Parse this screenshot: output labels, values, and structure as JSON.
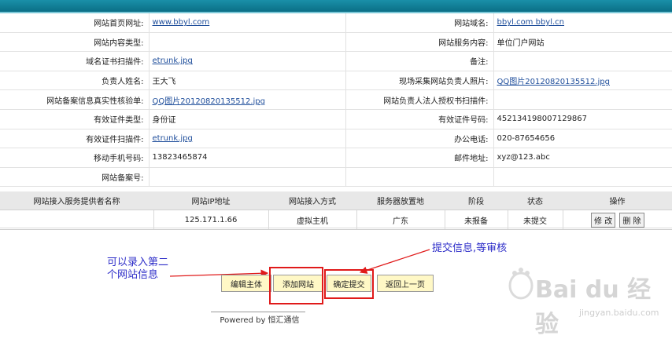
{
  "info_rows": [
    {
      "l1": "网站首页网址:",
      "v1": "www.bbyl.com",
      "l2": "网站域名:",
      "v2": "bbyl.com  bbyl.cn"
    },
    {
      "l1": "网站内容类型:",
      "v1": "",
      "l2": "网站服务内容:",
      "v2": "单位门户网站"
    },
    {
      "l1": "域名证书扫描件:",
      "v1": "etrunk.jpg",
      "l2": "备注:",
      "v2": ""
    },
    {
      "l1": "负责人姓名:",
      "v1": "王大飞",
      "l2": "现场采集网站负责人照片:",
      "v2": "QQ图片20120820135512.jpg"
    },
    {
      "l1": "网站备案信息真实性核验单:",
      "v1": "QQ图片20120820135512.jpg",
      "l2": "网站负责人法人授权书扫描件:",
      "v2": ""
    },
    {
      "l1": "有效证件类型:",
      "v1": "身份证",
      "l2": "有效证件号码:",
      "v2": "452134198007129867"
    },
    {
      "l1": "有效证件扫描件:",
      "v1": "etrunk.jpg",
      "l2": "办公电话:",
      "v2": "020-87654656"
    },
    {
      "l1": "移动手机号码:",
      "v1": "13823465874",
      "l2": "邮件地址:",
      "v2": "xyz@123.abc"
    },
    {
      "l1": "网站备案号:",
      "v1": "",
      "l2": "",
      "v2": ""
    }
  ],
  "service_table": {
    "headers": [
      "网站接入服务提供者名称",
      "网站IP地址",
      "网站接入方式",
      "服务器放置地",
      "阶段",
      "状态",
      "操作"
    ],
    "row": {
      "provider": "",
      "ip": "125.171.1.66",
      "method": "虚拟主机",
      "location": "广东",
      "stage": "未报备",
      "status": "未提交",
      "edit": "修 改",
      "delete": "删 除"
    }
  },
  "buttons": {
    "edit_entity": "编辑主体",
    "add_site": "添加网站",
    "confirm_submit": "确定提交",
    "back": "返回上一页"
  },
  "annotations": {
    "left_line1": "可以录入第二",
    "left_line2": "个网站信息",
    "right": "提交信息,等审核"
  },
  "footer": "Powered by 恒汇通信",
  "watermark": {
    "brand": "Bai du 经验",
    "url": "jingyan.baidu.com"
  },
  "colors": {
    "topbar": "#0b6f86",
    "link": "#1f4e9b",
    "button_bg": "#fff8c6",
    "highlight": "#e01a1a",
    "annotation": "#2c2cc8"
  }
}
